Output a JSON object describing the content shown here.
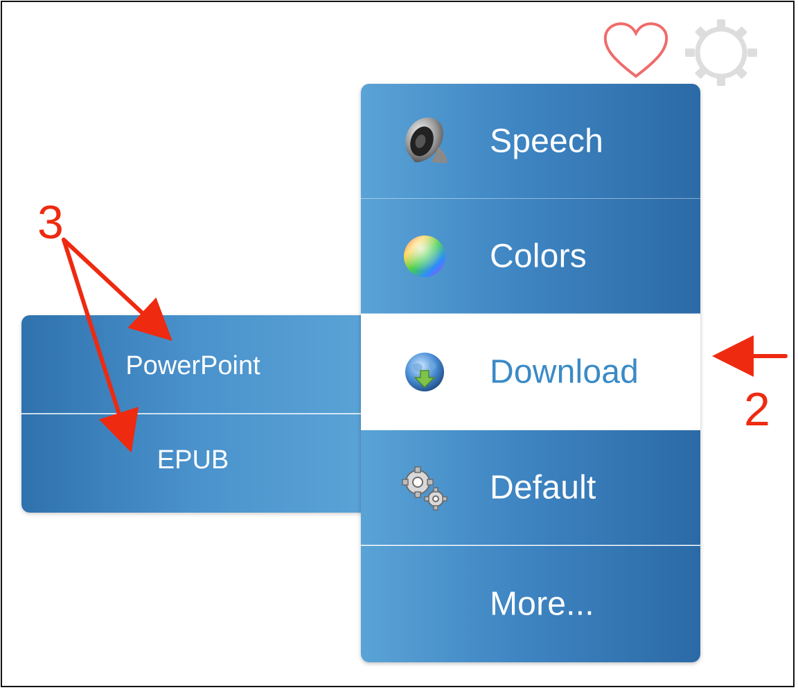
{
  "menu": {
    "items": [
      {
        "label": "Speech",
        "icon": "speaker-icon"
      },
      {
        "label": "Colors",
        "icon": "color-wheel-icon"
      },
      {
        "label": "Download",
        "icon": "globe-download-icon",
        "active": true
      },
      {
        "label": "Default",
        "icon": "gears-icon"
      },
      {
        "label": "More...",
        "icon": ""
      }
    ]
  },
  "submenu": {
    "items": [
      {
        "label": "PowerPoint"
      },
      {
        "label": "EPUB"
      }
    ]
  },
  "annotations": {
    "label_3": "3",
    "label_2": "2"
  },
  "colors": {
    "menu_blue": "#3f86c3",
    "active_text": "#3a8ac7",
    "annotation_red": "#ee2a10",
    "heart_stroke": "#f06b6b",
    "gear_stroke": "#dddddd"
  }
}
